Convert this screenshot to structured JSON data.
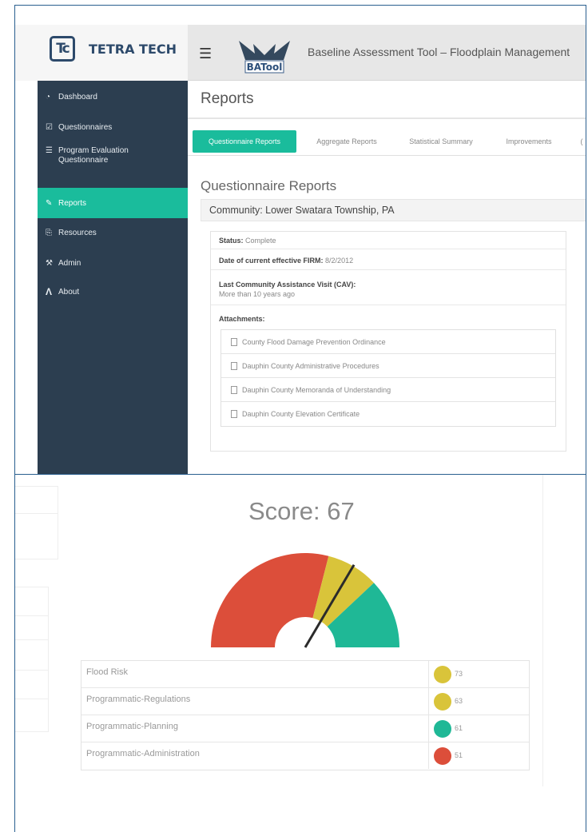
{
  "brand": {
    "logo_letters": "Tc",
    "name": "TETRA TECH"
  },
  "topbar": {
    "menu_icon": "hamburger-icon",
    "logo_text": "BATool",
    "title": "Baseline Assessment Tool – Floodplain Management"
  },
  "sidebar": {
    "items": [
      {
        "label": "Dashboard",
        "icon": "dashboard-icon",
        "glyph": "◔"
      },
      {
        "label": "Questionnaires",
        "icon": "checkbox-icon",
        "glyph": "☑"
      },
      {
        "label": "Program Evaluation Questionnaire",
        "icon": "list-icon",
        "glyph": "☰"
      },
      {
        "label": "Reports",
        "icon": "edit-icon",
        "glyph": "✎"
      },
      {
        "label": "Resources",
        "icon": "copy-icon",
        "glyph": "⎘"
      },
      {
        "label": "Admin",
        "icon": "wrench-icon",
        "glyph": "⚒"
      },
      {
        "label": "About",
        "icon": "lambda-icon",
        "glyph": "Λ"
      }
    ],
    "active": "Reports"
  },
  "main": {
    "page_title": "Reports",
    "tabs": [
      "Questionnaire Reports",
      "Aggregate Reports",
      "Statistical Summary",
      "Improvements",
      "("
    ],
    "active_tab": "Questionnaire Reports",
    "section_title": "Questionnaire Reports",
    "community": "Community: Lower Swatara Township, PA",
    "details": {
      "status_label": "Status:",
      "status_value": "Complete",
      "firm_label": "Date of current effective FIRM:",
      "firm_value": "8/2/2012",
      "cav_label": "Last Community Assistance Visit (CAV):",
      "cav_value": "More than 10 years ago",
      "attachments_label": "Attachments:"
    },
    "attachments": [
      "County Flood Damage Prevention Ordinance",
      "Dauphin County Administrative Procedures",
      "Dauphin County Memoranda of Understanding",
      "Dauphin County Elevation Certificate"
    ]
  },
  "score": {
    "title": "Score: 67",
    "value": 67,
    "gauge_colors": {
      "red": "#dc4e3a",
      "yellow": "#d9c43a",
      "green": "#1fb896",
      "needle": "#2b2b2b"
    },
    "categories": [
      {
        "name": "Flood Risk",
        "value": "73",
        "color": "#d9c43a"
      },
      {
        "name": "Programmatic-Regulations",
        "value": "63",
        "color": "#d9c43a"
      },
      {
        "name": "Programmatic-Planning",
        "value": "61",
        "color": "#1fb896"
      },
      {
        "name": "Programmatic-Administration",
        "value": "51",
        "color": "#dc4e3a"
      }
    ]
  }
}
